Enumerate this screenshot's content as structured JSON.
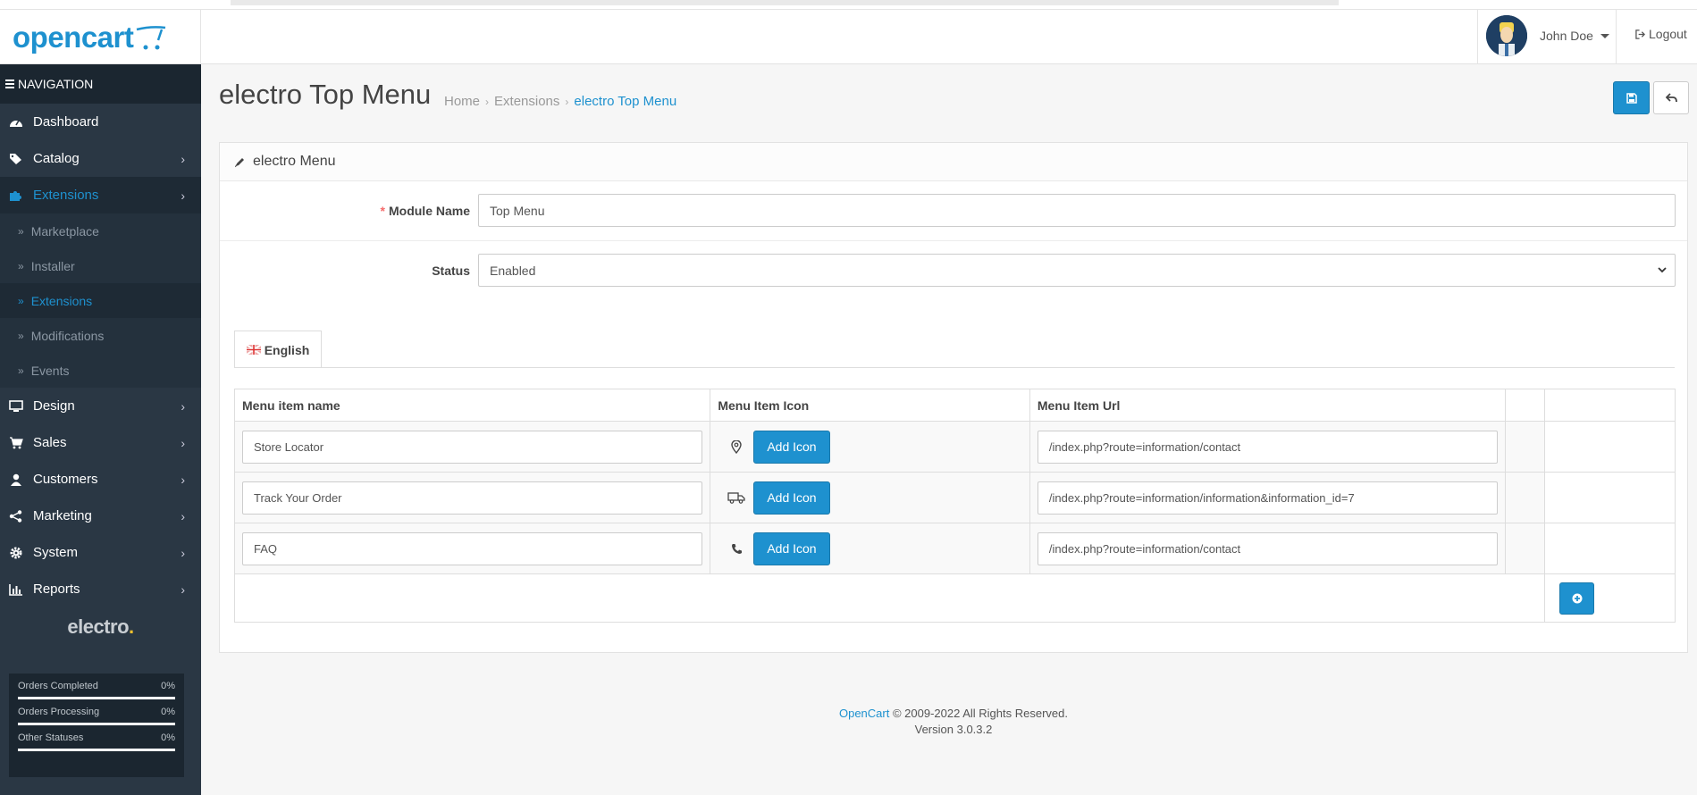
{
  "header": {
    "brand": "opencart",
    "user_name": "John Doe",
    "logout_label": "Logout"
  },
  "sidebar": {
    "title": "NAVIGATION",
    "items": [
      {
        "label": "Dashboard",
        "icon": "dashboard-icon"
      },
      {
        "label": "Catalog",
        "icon": "tags-icon"
      },
      {
        "label": "Extensions",
        "icon": "puzzle-icon"
      },
      {
        "label": "Design",
        "icon": "monitor-icon"
      },
      {
        "label": "Sales",
        "icon": "cart-icon"
      },
      {
        "label": "Customers",
        "icon": "user-icon"
      },
      {
        "label": "Marketing",
        "icon": "share-icon"
      },
      {
        "label": "System",
        "icon": "cog-icon"
      },
      {
        "label": "Reports",
        "icon": "bar-chart-icon"
      }
    ],
    "extensions_sub": [
      {
        "label": "Marketplace"
      },
      {
        "label": "Installer"
      },
      {
        "label": "Extensions"
      },
      {
        "label": "Modifications"
      },
      {
        "label": "Events"
      }
    ],
    "brand_logo": "electro",
    "stats": [
      {
        "label": "Orders Completed",
        "value": "0%"
      },
      {
        "label": "Orders Processing",
        "value": "0%"
      },
      {
        "label": "Other Statuses",
        "value": "0%"
      }
    ]
  },
  "page": {
    "title": "electro Top Menu",
    "breadcrumb": [
      "Home",
      "Extensions",
      "electro Top Menu"
    ]
  },
  "panel": {
    "heading": "electro Menu",
    "module_name_label": "Module Name",
    "module_name_value": "Top Menu",
    "status_label": "Status",
    "status_value": "Enabled",
    "language_tab": "English"
  },
  "table": {
    "headers": [
      "Menu item name",
      "Menu Item Icon",
      "Menu Item Url"
    ],
    "add_icon_label": "Add Icon",
    "rows": [
      {
        "name": "Store Locator",
        "icon": "map-marker-icon",
        "url": "/index.php?route=information/contact"
      },
      {
        "name": "Track Your Order",
        "icon": "truck-icon",
        "url": "/index.php?route=information/information&information_id=7"
      },
      {
        "name": "FAQ",
        "icon": "phone-icon",
        "url": "/index.php?route=information/contact"
      }
    ]
  },
  "footer": {
    "link": "OpenCart",
    "copyright": " © 2009-2022 All Rights Reserved.",
    "version": "Version 3.0.3.2"
  }
}
